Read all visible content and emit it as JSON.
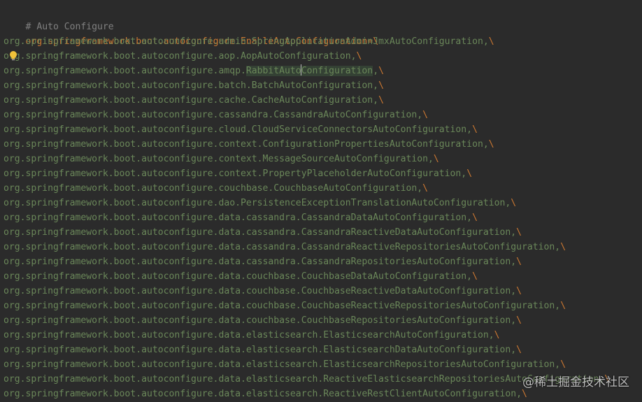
{
  "editor": {
    "comment": "# Auto Configure",
    "key": "org.springframework.boot.autoconfigure.EnableAutoConfiguration",
    "assign": "=",
    "continuation": "\\",
    "highlighted_line": {
      "prefix": "org.springframework.boot.autoconfigure.amqp.",
      "word_before_caret": "RabbitAuto",
      "word_after_caret": "Configuration",
      "suffix": ","
    },
    "values": [
      "org.springframework.boot.autoconfigure.admin.SpringApplicationAdminJmxAutoConfiguration,",
      "org.springframework.boot.autoconfigure.aop.AopAutoConfiguration,",
      "__HIGHLIGHT__",
      "org.springframework.boot.autoconfigure.batch.BatchAutoConfiguration,",
      "org.springframework.boot.autoconfigure.cache.CacheAutoConfiguration,",
      "org.springframework.boot.autoconfigure.cassandra.CassandraAutoConfiguration,",
      "org.springframework.boot.autoconfigure.cloud.CloudServiceConnectorsAutoConfiguration,",
      "org.springframework.boot.autoconfigure.context.ConfigurationPropertiesAutoConfiguration,",
      "org.springframework.boot.autoconfigure.context.MessageSourceAutoConfiguration,",
      "org.springframework.boot.autoconfigure.context.PropertyPlaceholderAutoConfiguration,",
      "org.springframework.boot.autoconfigure.couchbase.CouchbaseAutoConfiguration,",
      "org.springframework.boot.autoconfigure.dao.PersistenceExceptionTranslationAutoConfiguration,",
      "org.springframework.boot.autoconfigure.data.cassandra.CassandraDataAutoConfiguration,",
      "org.springframework.boot.autoconfigure.data.cassandra.CassandraReactiveDataAutoConfiguration,",
      "org.springframework.boot.autoconfigure.data.cassandra.CassandraReactiveRepositoriesAutoConfiguration,",
      "org.springframework.boot.autoconfigure.data.cassandra.CassandraRepositoriesAutoConfiguration,",
      "org.springframework.boot.autoconfigure.data.couchbase.CouchbaseDataAutoConfiguration,",
      "org.springframework.boot.autoconfigure.data.couchbase.CouchbaseReactiveDataAutoConfiguration,",
      "org.springframework.boot.autoconfigure.data.couchbase.CouchbaseReactiveRepositoriesAutoConfiguration,",
      "org.springframework.boot.autoconfigure.data.couchbase.CouchbaseRepositoriesAutoConfiguration,",
      "org.springframework.boot.autoconfigure.data.elasticsearch.ElasticsearchAutoConfiguration,",
      "org.springframework.boot.autoconfigure.data.elasticsearch.ElasticsearchDataAutoConfiguration,",
      "org.springframework.boot.autoconfigure.data.elasticsearch.ElasticsearchRepositoriesAutoConfiguration,",
      "org.springframework.boot.autoconfigure.data.elasticsearch.ReactiveElasticsearchRepositoriesAutoConfiguration,",
      "org.springframework.boot.autoconfigure.data.elasticsearch.ReactiveRestClientAutoConfiguration,"
    ],
    "colors": {
      "background": "#2b2b2b",
      "comment": "#808080",
      "key": "#cc7832",
      "value": "#6a8759",
      "highlight": "#344134"
    },
    "gutter_icon": "lightbulb-icon"
  },
  "watermark": "@稀土掘金技术社区"
}
